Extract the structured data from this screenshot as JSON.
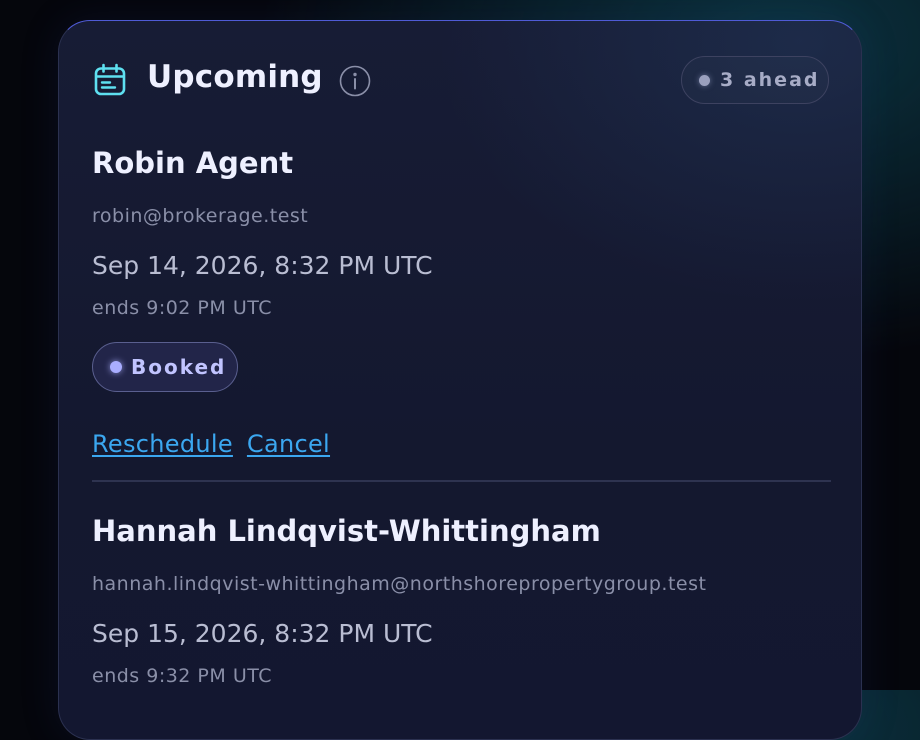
{
  "header": {
    "title": "Upcoming",
    "info_icon": "info-icon",
    "calendar_icon": "calendar-icon",
    "ahead_label": "3 ahead"
  },
  "appointments": [
    {
      "name": "Robin Agent",
      "email": "robin@brokerage.test",
      "when": "Sep 14, 2026, 8:32 PM UTC",
      "ends": "ends 9:02 PM UTC",
      "status": "Booked",
      "actions": {
        "reschedule": "Reschedule",
        "cancel": "Cancel"
      }
    },
    {
      "name": "Hannah Lindqvist-Whittingham",
      "email": "hannah.lindqvist-whittingham@northshorepropertygroup.test",
      "when": "Sep 15, 2026, 8:32 PM UTC",
      "ends": "ends 9:32 PM UTC"
    }
  ],
  "colors": {
    "accent_link": "#3ba7f0",
    "calendar_icon": "#5ee0f0",
    "status_booked": "#a9adff",
    "card_bg": "#161a33",
    "page_bg": "#05060c"
  }
}
